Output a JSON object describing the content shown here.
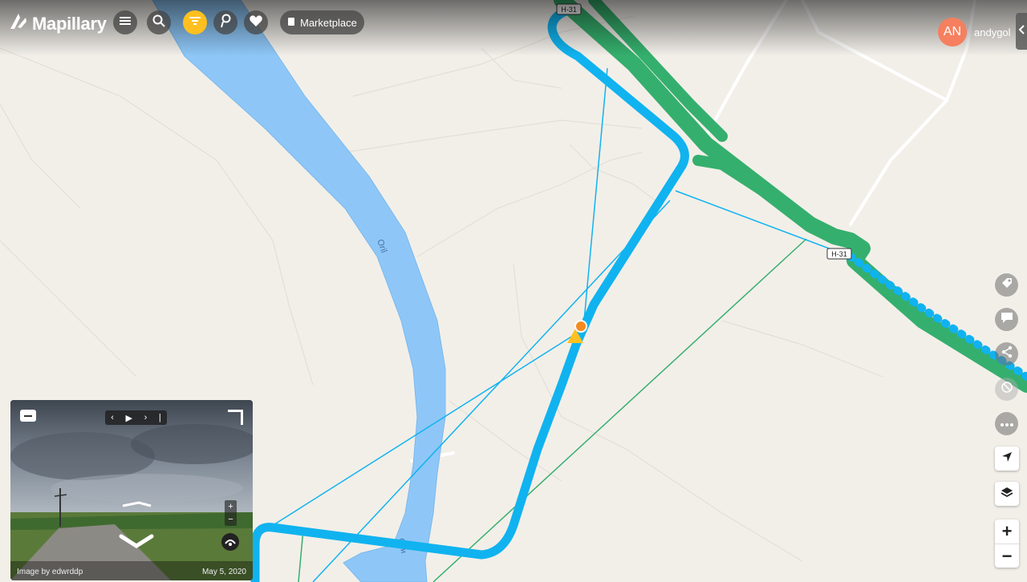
{
  "app": {
    "name": "Mapillary"
  },
  "header": {
    "marketplace_label": "Marketplace",
    "user_initials": "AN",
    "username": "andygol"
  },
  "map": {
    "road_shield_1": "H-31",
    "road_shield_2": "H-31",
    "river_label_1": "Oril",
    "river_label_2": "Ори"
  },
  "viewer": {
    "image_by": "Image by edwrddp",
    "date": "May 5, 2020",
    "zoom_in": "+",
    "zoom_out": "−"
  },
  "controls": {
    "zoom_in": "+",
    "zoom_out": "−"
  },
  "colors": {
    "accent": "#ffc01f",
    "sequence_blue": "#10b3ef",
    "sequence_green": "#35af6d",
    "water": "#8ec7f7",
    "land": "#f2efe9",
    "avatar": "#f57f5f"
  },
  "icons": [
    "mapillary-logo-icon",
    "menu-icon",
    "search-icon",
    "filter-icon",
    "route-icon",
    "heart-map-icon",
    "marketplace-icon",
    "tag-icon",
    "comment-icon",
    "share-icon",
    "block-icon",
    "more-icon",
    "locate-icon",
    "layers-icon"
  ]
}
